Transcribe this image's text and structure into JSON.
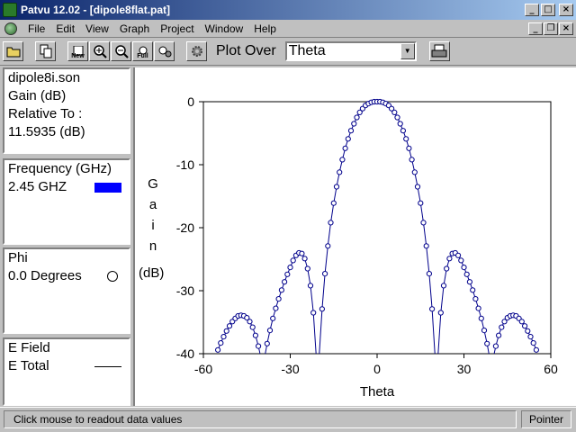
{
  "window": {
    "title": "Patvu 12.02 - [dipole8flat.pat]"
  },
  "menu": {
    "items": [
      {
        "label": "File"
      },
      {
        "label": "Edit"
      },
      {
        "label": "View"
      },
      {
        "label": "Graph"
      },
      {
        "label": "Project"
      },
      {
        "label": "Window"
      },
      {
        "label": "Help"
      }
    ]
  },
  "toolbar": {
    "new_label": "New",
    "full_label": "Full",
    "plot_over_label": "Plot Over",
    "plot_over_value": "Theta"
  },
  "info": {
    "file": "dipole8i.son",
    "quantity": "Gain (dB)",
    "relative_label": "Relative To :",
    "relative_value": "11.5935 (dB)"
  },
  "frequency": {
    "header": "Frequency (GHz)",
    "value": "2.45 GHZ",
    "color": "#0000ff"
  },
  "phi": {
    "header": "Phi",
    "value": "0.0 Degrees"
  },
  "field": {
    "header": "E Field",
    "value": "E Total"
  },
  "chart_data": {
    "type": "scatter",
    "xlabel": "Theta",
    "ylabel": "Gain (dB)",
    "xlim": [
      -60,
      60
    ],
    "ylim": [
      -40,
      0
    ],
    "xticks": [
      "-60",
      "-30",
      "0",
      "30",
      "60"
    ],
    "yticks": [
      "0",
      "-10",
      "-20",
      "-30",
      "-40"
    ],
    "series": [
      {
        "color": "#00008b",
        "x": [
          -55,
          -54,
          -53,
          -52,
          -51,
          -50,
          -49,
          -48,
          -47,
          -46,
          -45,
          -44,
          -43,
          -42,
          -41,
          -40,
          -39,
          -38,
          -37,
          -36,
          -35,
          -34,
          -33,
          -32,
          -31,
          -30,
          -29,
          -28,
          -27,
          -26,
          -25,
          -24,
          -23,
          -22,
          -21,
          -20,
          -19,
          -18,
          -17,
          -16,
          -15,
          -14,
          -13,
          -12,
          -11,
          -10,
          -9,
          -8,
          -7,
          -6,
          -5,
          -4,
          -3,
          -2,
          -1,
          0,
          1,
          2,
          3,
          4,
          5,
          6,
          7,
          8,
          9,
          10,
          11,
          12,
          13,
          14,
          15,
          16,
          17,
          18,
          19,
          20,
          21,
          22,
          23,
          24,
          25,
          26,
          27,
          28,
          29,
          30,
          31,
          32,
          33,
          34,
          35,
          36,
          37,
          38,
          39,
          40,
          41,
          42,
          43,
          44,
          45,
          46,
          47,
          48,
          49,
          50,
          51,
          52,
          53,
          54,
          55
        ],
        "y": [
          -39.4,
          -38.3,
          -37.3,
          -36.4,
          -35.6,
          -34.9,
          -34.4,
          -34.0,
          -33.9,
          -34.0,
          -34.3,
          -34.9,
          -35.8,
          -37.1,
          -38.8,
          -40.9,
          -40.9,
          -38.4,
          -36.3,
          -34.4,
          -32.8,
          -31.3,
          -29.9,
          -28.6,
          -27.4,
          -26.3,
          -25.2,
          -24.4,
          -24.0,
          -24.1,
          -24.9,
          -26.5,
          -29.2,
          -33.5,
          -40.5,
          -40.2,
          -32.9,
          -27.3,
          -22.9,
          -19.2,
          -16.1,
          -13.5,
          -11.2,
          -9.2,
          -7.4,
          -5.9,
          -4.6,
          -3.5,
          -2.5,
          -1.7,
          -1.1,
          -0.6,
          -0.3,
          -0.1,
          0.0,
          0.0,
          0.0,
          -0.1,
          -0.3,
          -0.6,
          -1.1,
          -1.7,
          -2.5,
          -3.5,
          -4.6,
          -5.9,
          -7.4,
          -9.2,
          -11.2,
          -13.5,
          -16.1,
          -19.2,
          -22.9,
          -27.3,
          -32.9,
          -40.2,
          -40.5,
          -33.5,
          -29.2,
          -26.5,
          -24.9,
          -24.1,
          -24.0,
          -24.4,
          -25.2,
          -26.3,
          -27.4,
          -28.6,
          -29.9,
          -31.3,
          -32.8,
          -34.4,
          -36.3,
          -38.4,
          -40.9,
          -40.9,
          -38.8,
          -37.1,
          -35.8,
          -34.9,
          -34.3,
          -34.0,
          -33.9,
          -34.0,
          -34.4,
          -34.9,
          -35.6,
          -36.4,
          -37.3,
          -38.3,
          -39.4
        ]
      }
    ]
  },
  "status": {
    "hint": "Click mouse to readout data values",
    "mode": "Pointer"
  }
}
